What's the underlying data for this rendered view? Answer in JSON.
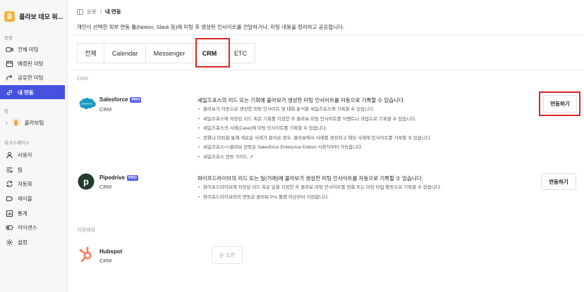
{
  "workspace": {
    "logo_char": "콜",
    "name": "콜라보 데모 워..."
  },
  "sidebar": {
    "section_apps": "응용",
    "items": [
      {
        "label": "전체 미팅",
        "icon": "video-icon"
      },
      {
        "label": "예정된 미팅",
        "icon": "calendar-icon"
      },
      {
        "label": "공유한 미팅",
        "icon": "share-icon"
      },
      {
        "label": "내 연동",
        "icon": "link-icon",
        "active": true
      }
    ],
    "section_team": "팀",
    "team": {
      "logo_char": "콜",
      "label": "콜라보팀"
    },
    "section_workspace": "워크스페이스",
    "ws_items": [
      {
        "label": "사용자",
        "icon": "user-icon"
      },
      {
        "label": "팀",
        "icon": "team-icon"
      },
      {
        "label": "자동화",
        "icon": "automation-icon"
      },
      {
        "label": "레이블",
        "icon": "label-icon"
      },
      {
        "label": "통계",
        "icon": "stats-icon"
      },
      {
        "label": "라이센스",
        "icon": "license-icon"
      },
      {
        "label": "설정",
        "icon": "gear-icon"
      }
    ]
  },
  "breadcrumb": {
    "parent": "응용",
    "sep": "/",
    "current": "내 연동"
  },
  "description": "개인이 선택한 외부 연동 툴(Notion, Slack 등)에 미팅 후 생성된 인사이트를 전달하거나, 미팅 내용을 정리하고 공유합니다.",
  "tabs": [
    {
      "label": "전체"
    },
    {
      "label": "Calendar"
    },
    {
      "label": "Messenger"
    },
    {
      "label": "CRM",
      "active": true
    },
    {
      "label": "ETC"
    }
  ],
  "groups": {
    "crm": "CRM",
    "upcoming": "지원예정"
  },
  "integrations": {
    "salesforce": {
      "name": "Salesforce",
      "badge": "PRO",
      "category": "CRM",
      "logo_text": "salesforce",
      "title": "세일즈포스의 리드 또는 기회에 콜라보가 생성한 미팅 인사이트를 자동으로 기록할 수 있습니다.",
      "bullets": [
        "콜라보가 자동으로 생성한 미팅 인사이트 및 대화 분석을 세일즈포스에 기록할 수 있습니다.",
        "세일즈포스에 저장된 리드 혹은 기회를 지정한 후 콜라보 미팅 인사이트를 이벤트나 과업으로 기록할 수 있습니다.",
        "세일즈포스의 사례(Case)에 미팅 인사이트를 기록할 수 있습니다.",
        "전화나 미팅을 통해 새로운 사례가 들어온 경우, 콜라보에서 사례를 생성하고 해당 사례에 인사이트를 기록할 수 있습니다.",
        "세일즈포스<>콜라보 연동은 Salesforce Enterprise Edition 사용자부터 가능합니다."
      ],
      "guide_link": "세일즈포스 연동 가이드",
      "button": "연동하기"
    },
    "pipedrive": {
      "name": "Pipedrive",
      "badge": "PRO",
      "category": "CRM",
      "logo_char": "p",
      "title": "파이프드라이브의 리드 또는 딜(거래)에 콜라보가 생성한 미팅 인사이트를 자동으로 기록할 수 있습니다.",
      "bullets": [
        "파이프드라이브에 저장된 리드 혹은 딜을 지정한 후 콜라보 미팅 인사이트를 전화 또는 미팅 타입 활동으로 기록할 수 있습니다.",
        "파이프드라이브와의 연동은 콜라보 Pro 플랜 이상부터 지원합니다."
      ],
      "button": "연동하기"
    },
    "hubspot": {
      "name": "Hubspot",
      "category": "CRM",
      "button": "곧 오픈"
    }
  },
  "colors": {
    "accent": "#4651e0",
    "pro_badge": "#5b5fe8",
    "highlight": "#d9262c",
    "salesforce": "#1798c1",
    "pipedrive": "#1f3b2e",
    "hubspot": "#ff7a59"
  }
}
